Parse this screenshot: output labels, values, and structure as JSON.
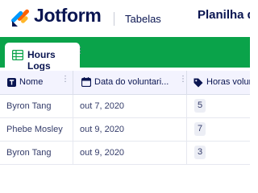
{
  "header": {
    "brand": "Jotform",
    "product": "Tabelas",
    "doc_title": "Planilha de"
  },
  "tabs": [
    {
      "label": "Hours Logs"
    }
  ],
  "table": {
    "columns": [
      {
        "label": "Nome",
        "icon": "text-type-icon"
      },
      {
        "label": "Data do voluntari...",
        "icon": "calendar-icon"
      },
      {
        "label": "Horas volun",
        "icon": "tag-icon"
      }
    ],
    "rows": [
      {
        "name": "Byron Tang",
        "date": "out 7, 2020",
        "hours": "5"
      },
      {
        "name": "Phebe Mosley",
        "date": "out 9, 2020",
        "hours": "7"
      },
      {
        "name": "Byron Tang",
        "date": "out 9, 2020",
        "hours": "3"
      }
    ]
  },
  "colors": {
    "brand_navy": "#0a1551",
    "tab_bar_green": "#0aa34a",
    "logo_orange": "#ff6100",
    "logo_blue": "#0099ff",
    "logo_yellow": "#ffb629"
  }
}
